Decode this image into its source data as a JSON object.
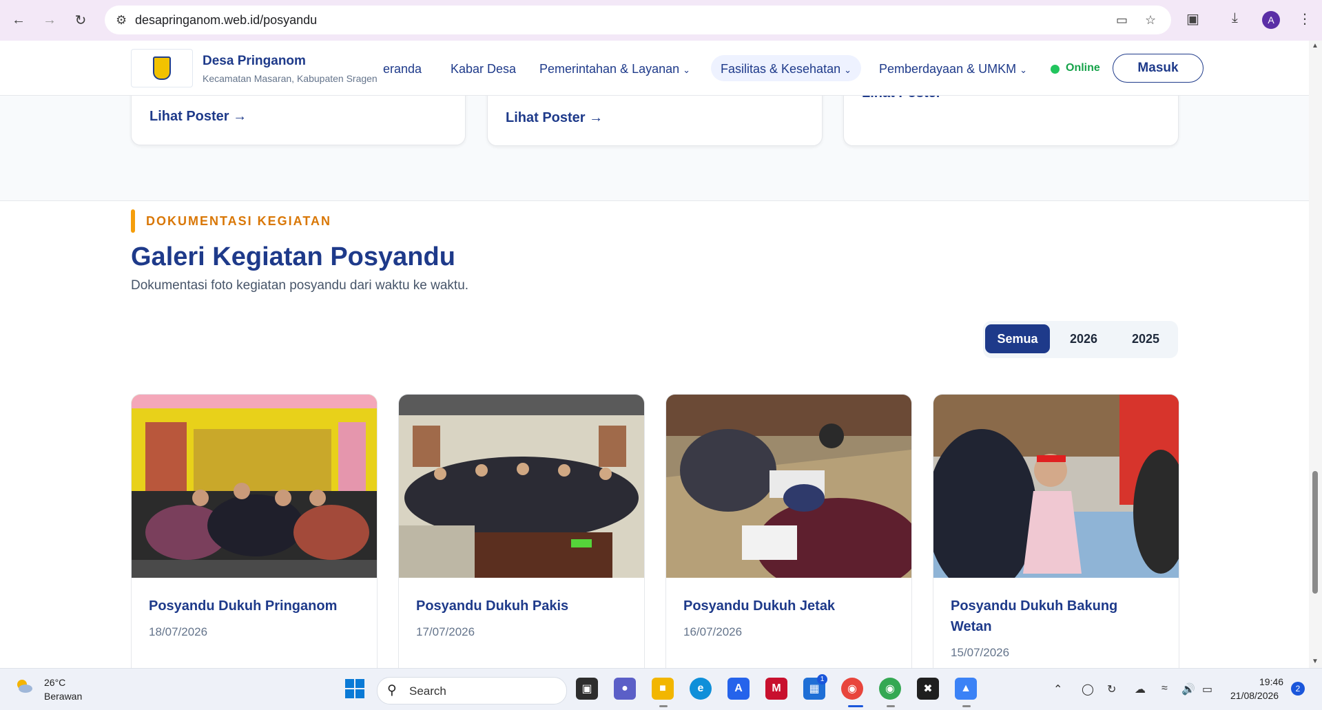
{
  "browser": {
    "url": "desapringanom.web.id/posyandu",
    "profile_initial": "A"
  },
  "site": {
    "name": "Desa Pringanom",
    "subtitle": "Kecamatan Masaran, Kabupaten Sragen",
    "menu": [
      {
        "label": "Beranda",
        "visible_text": "eranda"
      },
      {
        "label": "Kabar Desa"
      },
      {
        "label": "Pemerintahan & Layanan"
      },
      {
        "label": "Fasilitas & Kesehatan"
      },
      {
        "label": "Pemberdayaan & UMKM"
      }
    ],
    "status": "Online",
    "login": "Masuk"
  },
  "posters": {
    "link_label": "Lihat Poster →",
    "partial_label": "Lihat Poster"
  },
  "gallery": {
    "eyebrow": "DOKUMENTASI KEGIATAN",
    "title": "Galeri Kegiatan Posyandu",
    "subtitle": "Dokumentasi foto kegiatan posyandu dari waktu ke waktu.",
    "filters": [
      "Semua",
      "2026",
      "2025"
    ],
    "active_filter": "Semua",
    "items": [
      {
        "title": "Posyandu Dukuh Pringanom",
        "date": "18/07/2026"
      },
      {
        "title": "Posyandu Dukuh Pakis",
        "date": "17/07/2026"
      },
      {
        "title": "Posyandu Dukuh Jetak",
        "date": "16/07/2026"
      },
      {
        "title": "Posyandu Dukuh Bakung Wetan",
        "date": "15/07/2026"
      }
    ]
  },
  "taskbar": {
    "weather_temp": "26°C",
    "weather_desc": "Berawan",
    "search_label": "Search",
    "store_badge": "1",
    "time": "19:46",
    "date": "21/08/2026",
    "notification_count": "2"
  },
  "colors": {
    "brand": "#1e3a8a",
    "accent": "#f59e0b",
    "online": "#22c55e"
  }
}
